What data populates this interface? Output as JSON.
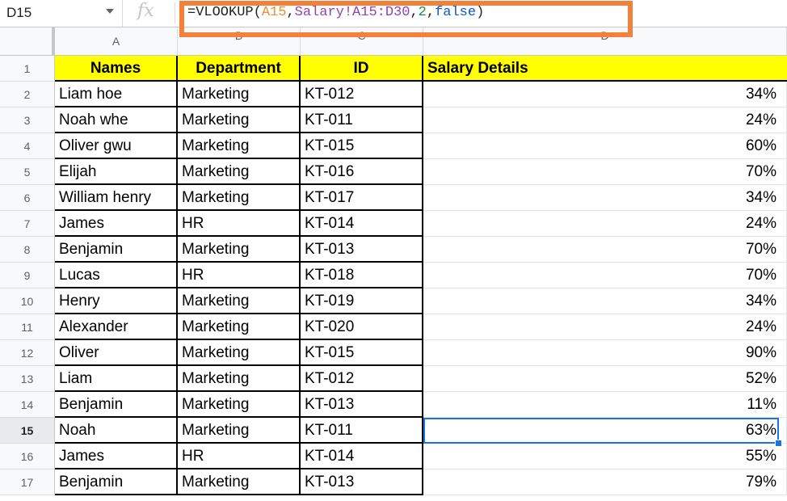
{
  "formula_bar": {
    "cell_reference": "D15",
    "fx_symbol": "fx",
    "formula_parts": {
      "prefix": "=VLOOKUP(",
      "ref1": "A15",
      "sep1": ",",
      "ref2": "Salary!A15:D30",
      "sep2": ",",
      "index": "2",
      "sep3": ",",
      "flag": "false",
      "suffix": ")"
    }
  },
  "columns": [
    "A",
    "B",
    "C",
    "D"
  ],
  "header_row": {
    "row_number": "1",
    "names": "Names",
    "department": "Department",
    "id": "ID",
    "salary": "Salary Details"
  },
  "rows": [
    {
      "n": "2",
      "name": "Liam hoe",
      "dept": "Marketing",
      "id": "KT-012",
      "salary": "34%"
    },
    {
      "n": "3",
      "name": "Noah whe",
      "dept": "Marketing",
      "id": "KT-011",
      "salary": "24%"
    },
    {
      "n": "4",
      "name": "Oliver gwu",
      "dept": "Marketing",
      "id": "KT-015",
      "salary": "60%"
    },
    {
      "n": "5",
      "name": "Elijah",
      "dept": "Marketing",
      "id": "KT-016",
      "salary": "70%"
    },
    {
      "n": "6",
      "name": "William henry",
      "dept": "Marketing",
      "id": "KT-017",
      "salary": "34%"
    },
    {
      "n": "7",
      "name": "James",
      "dept": "HR",
      "id": "KT-014",
      "salary": "24%"
    },
    {
      "n": "8",
      "name": "Benjamin",
      "dept": "Marketing",
      "id": "KT-013",
      "salary": "70%"
    },
    {
      "n": "9",
      "name": "Lucas",
      "dept": "HR",
      "id": "KT-018",
      "salary": "70%"
    },
    {
      "n": "10",
      "name": "Henry",
      "dept": "Marketing",
      "id": "KT-019",
      "salary": "34%"
    },
    {
      "n": "11",
      "name": "Alexander",
      "dept": "Marketing",
      "id": "KT-020",
      "salary": "24%"
    },
    {
      "n": "12",
      "name": "Oliver",
      "dept": "Marketing",
      "id": "KT-015",
      "salary": "90%"
    },
    {
      "n": "13",
      "name": "Liam",
      "dept": "Marketing",
      "id": "KT-012",
      "salary": "52%"
    },
    {
      "n": "14",
      "name": "Benjamin",
      "dept": "Marketing",
      "id": "KT-013",
      "salary": "11%"
    },
    {
      "n": "15",
      "name": "Noah",
      "dept": "Marketing",
      "id": "KT-011",
      "salary": "63%"
    },
    {
      "n": "16",
      "name": "James",
      "dept": "HR",
      "id": "KT-014",
      "salary": "55%"
    },
    {
      "n": "17",
      "name": "Benjamin",
      "dept": "Marketing",
      "id": "KT-013",
      "salary": "79%"
    }
  ],
  "selected_row": "15",
  "colors": {
    "header_fill": "#ffff00",
    "highlight_outline": "#f4803a",
    "selection": "#1a73e8"
  }
}
